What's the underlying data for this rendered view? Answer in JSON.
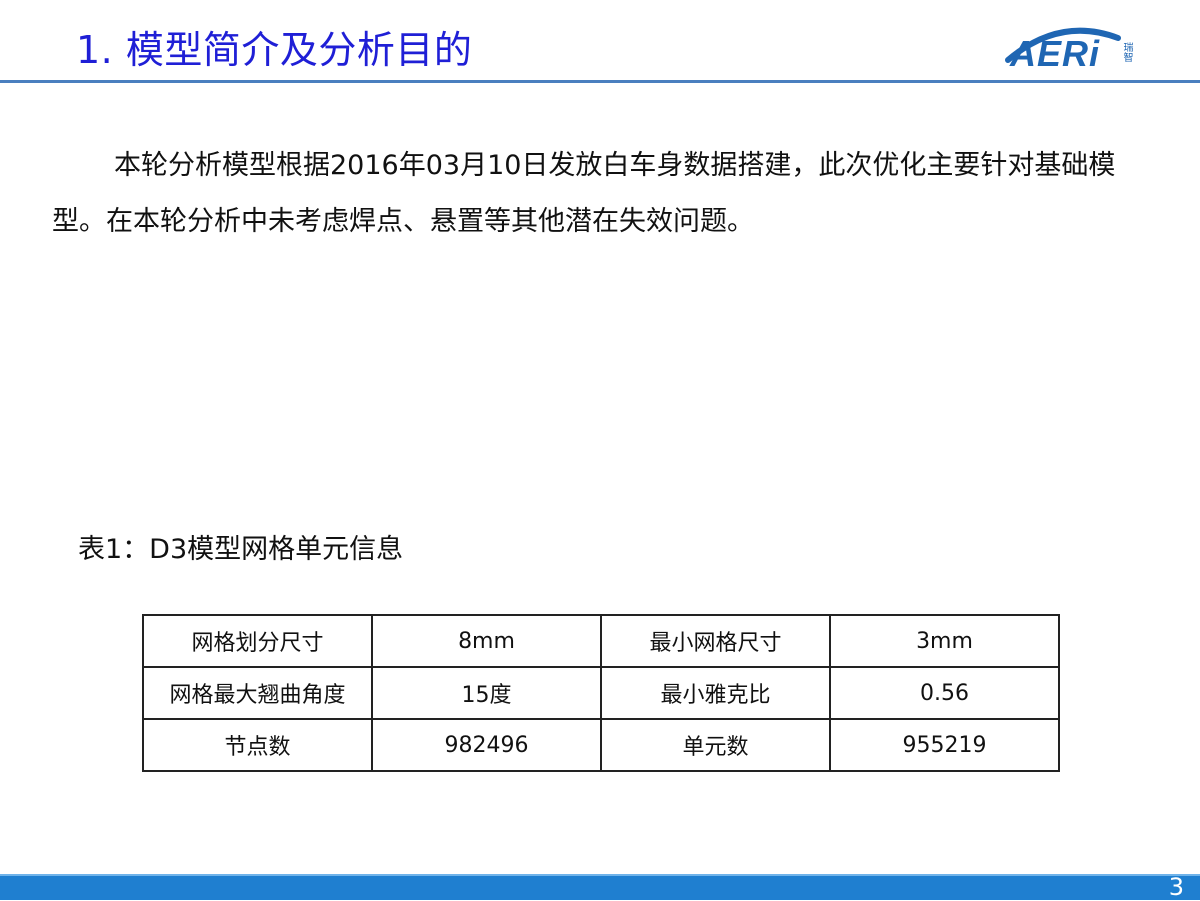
{
  "slide": {
    "title": "1. 模型简介及分析目的",
    "page_number": "3"
  },
  "logo": {
    "text": "AERi",
    "side_text": "瑞智",
    "color": "#1f66b3"
  },
  "intro": {
    "text": "本轮分析模型根据2016年03月10日发放白车身数据搭建，此次优化主要针对基础模型。在本轮分析中未考虑焊点、悬置等其他潜在失效问题。"
  },
  "table": {
    "caption": "表1：D3模型网格单元信息",
    "rows": [
      [
        "网格划分尺寸",
        "8mm",
        "最小网格尺寸",
        "3mm"
      ],
      [
        "网格最大翘曲角度",
        "15度",
        "最小雅克比",
        "0.56"
      ],
      [
        "节点数",
        "982496",
        "单元数",
        "955219"
      ]
    ]
  },
  "colors": {
    "title": "#1f1fd6",
    "header_rule": "#4a7fbf",
    "footer": "#1f7fd0"
  }
}
